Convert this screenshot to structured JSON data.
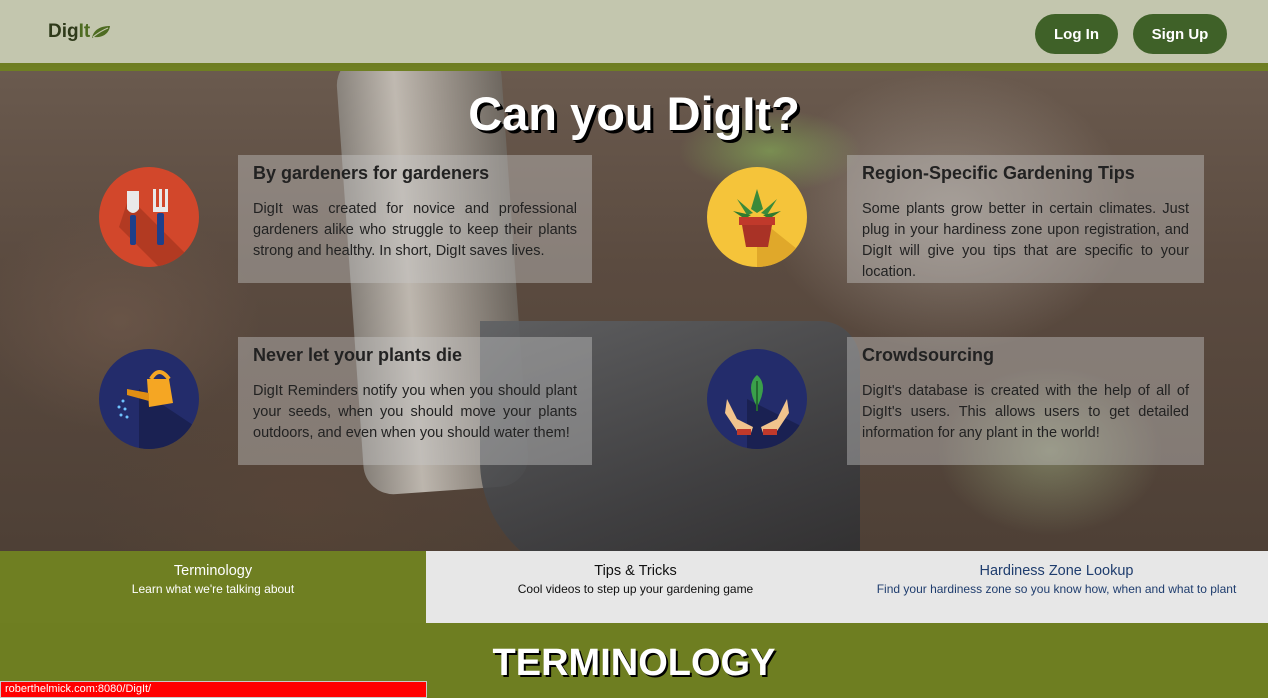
{
  "header": {
    "logo_text": "DigIt",
    "logo_prefix": "Dig",
    "logo_suffix": "It",
    "login_label": "Log In",
    "signup_label": "Sign Up"
  },
  "hero": {
    "title": "Can you DigIt?",
    "features": [
      {
        "title": "By gardeners for gardeners",
        "text": "DigIt was created for novice and professional gardeners alike who struggle to keep their plants strong and healthy. In short, DigIt saves lives.",
        "icon": "garden-tools-icon"
      },
      {
        "title": "Region-Specific Gardening Tips",
        "text": "Some plants grow better in certain climates. Just plug in your hardiness zone upon registration, and DigIt will give you tips that are specific to your location.",
        "icon": "potted-plant-icon"
      },
      {
        "title": "Never let your plants die",
        "text": "DigIt Reminders notify you when you should plant your seeds, when you should move your plants outdoors, and even when you should water them!",
        "icon": "watering-can-icon"
      },
      {
        "title": "Crowdsourcing",
        "text": "DigIt's database is created with the help of all of DigIt's users. This allows users to get detailed information for any plant in the world!",
        "icon": "hands-leaf-icon"
      }
    ]
  },
  "tabs": [
    {
      "title": "Terminology",
      "subtitle": "Learn what we're talking about"
    },
    {
      "title": "Tips & Tricks",
      "subtitle": "Cool videos to step up your gardening game"
    },
    {
      "title": "Hardiness Zone Lookup",
      "subtitle": "Find your hardiness zone so you know how, when and what to plant"
    }
  ],
  "section": {
    "title": "TERMINOLOGY"
  },
  "status_bar": {
    "url": "roberthelmick.com:8080/DigIt/"
  },
  "colors": {
    "header_bg": "#c3c6ae",
    "button_bg": "#3f6128",
    "accent_green": "#6f7f22",
    "status_red": "#ff0000"
  }
}
